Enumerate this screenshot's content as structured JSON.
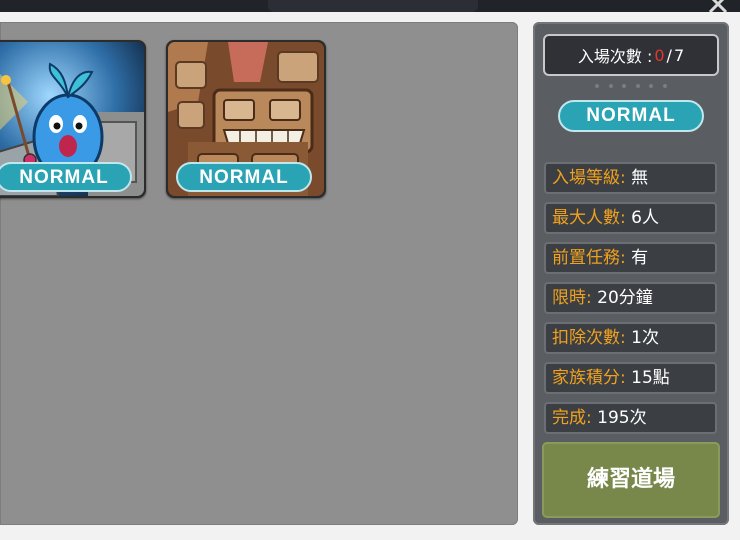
{
  "dungeon_cards": [
    {
      "name": "blue-sprout-monster",
      "difficulty": "NORMAL"
    },
    {
      "name": "stone-totem-golem",
      "difficulty": "NORMAL"
    }
  ],
  "entry": {
    "label": "入場次數 : ",
    "used": "0",
    "separator": " / ",
    "max": "7"
  },
  "difficulty_badge": "NORMAL",
  "info_rows": [
    {
      "key": "入場等級:",
      "value": "無"
    },
    {
      "key": "最大人數:",
      "value": "6人"
    },
    {
      "key": "前置任務:",
      "value": "有"
    },
    {
      "key": "限時:",
      "value": "20分鐘"
    },
    {
      "key": "扣除次數:",
      "value": "1次"
    },
    {
      "key": "家族積分:",
      "value": "15點"
    },
    {
      "key": "完成:",
      "value": "195次"
    }
  ],
  "practice_button": "練習道場",
  "colors": {
    "accent_teal": "#2aa3b5",
    "key_orange": "#f0a11e",
    "button_green": "#77884a",
    "count_red": "#e2372b"
  }
}
